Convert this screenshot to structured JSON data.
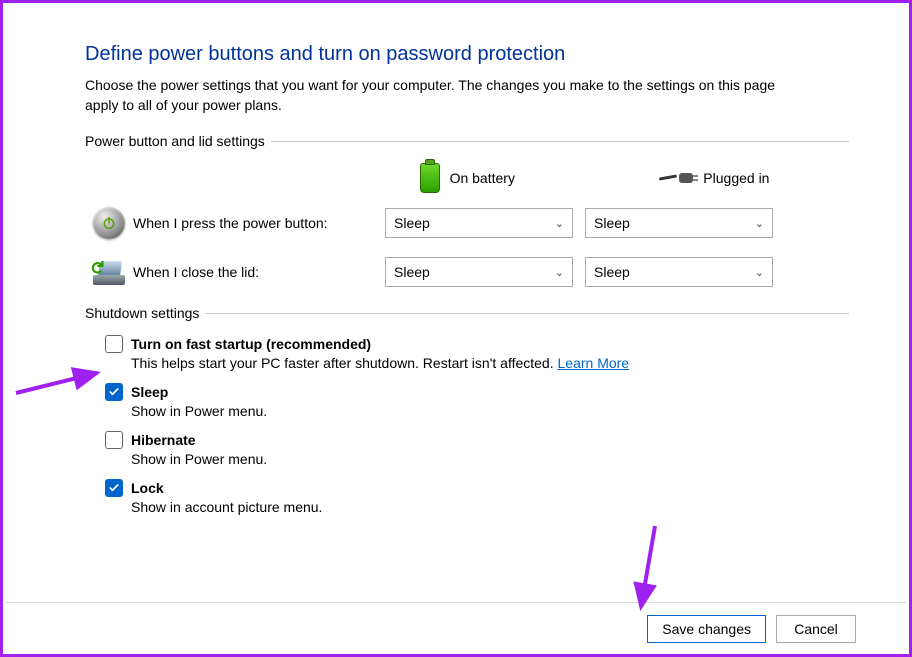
{
  "page": {
    "title": "Define power buttons and turn on password protection",
    "description": "Choose the power settings that you want for your computer. The changes you make to the settings on this page apply to all of your power plans."
  },
  "sections": {
    "power_lid": {
      "header": "Power button and lid settings",
      "col_battery": "On battery",
      "col_plugged": "Plugged in",
      "rows": [
        {
          "label": "When I press the power button:",
          "battery": "Sleep",
          "plugged": "Sleep"
        },
        {
          "label": "When I close the lid:",
          "battery": "Sleep",
          "plugged": "Sleep"
        }
      ]
    },
    "shutdown": {
      "header": "Shutdown settings",
      "items": [
        {
          "label": "Turn on fast startup (recommended)",
          "desc": "This helps start your PC faster after shutdown. Restart isn't affected. ",
          "link": "Learn More",
          "checked": false
        },
        {
          "label": "Sleep",
          "desc": "Show in Power menu.",
          "link": null,
          "checked": true
        },
        {
          "label": "Hibernate",
          "desc": "Show in Power menu.",
          "link": null,
          "checked": false
        },
        {
          "label": "Lock",
          "desc": "Show in account picture menu.",
          "link": null,
          "checked": true
        }
      ]
    }
  },
  "footer": {
    "save": "Save changes",
    "cancel": "Cancel"
  },
  "colors": {
    "accent": "#0066cc",
    "annotation": "#a020f0"
  }
}
